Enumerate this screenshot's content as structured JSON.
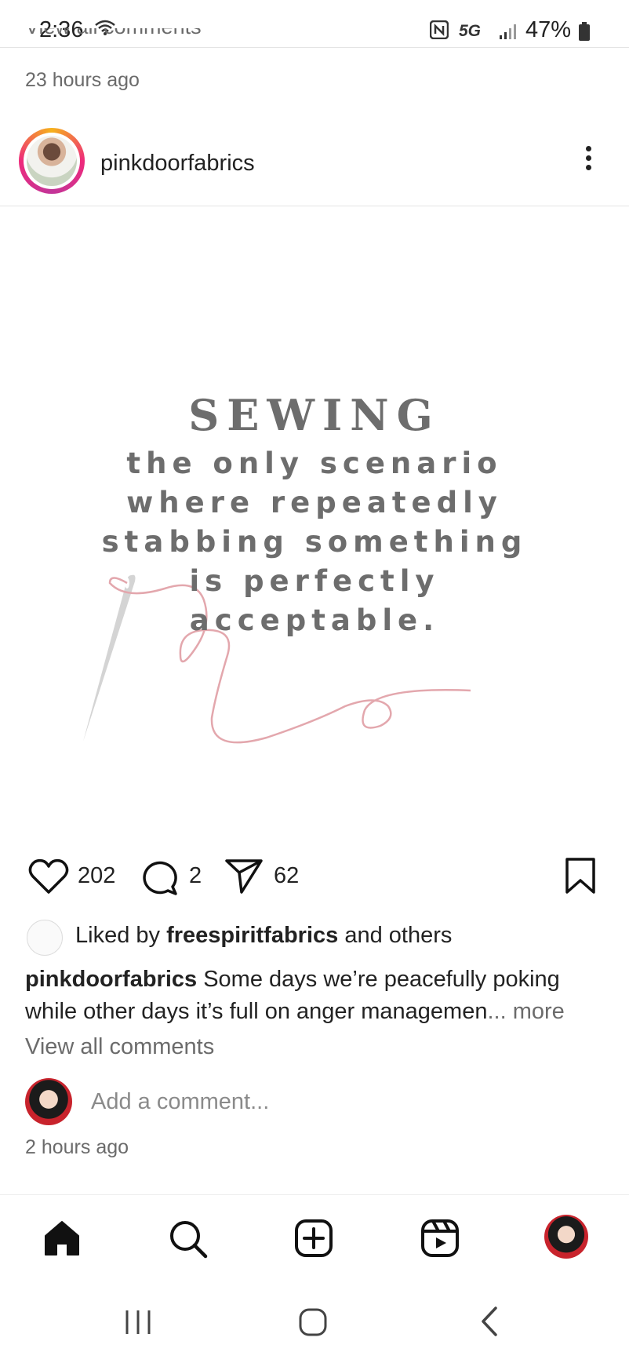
{
  "status_bar": {
    "time": "2:36",
    "network": "5G",
    "battery": "47%"
  },
  "previous_post": {
    "comments_link": "View all comments",
    "timestamp": "23 hours ago"
  },
  "post": {
    "username": "pinkdoorfabrics",
    "image_text": {
      "title": "SEWING",
      "lines": [
        "the only scenario",
        "where repeatedly",
        "stabbing something",
        "is perfectly",
        "acceptable."
      ]
    },
    "actions": {
      "likes": "202",
      "comments": "2",
      "shares": "62"
    },
    "liked_by": {
      "prefix": "Liked by ",
      "user": "freespiritfabrics",
      "suffix": " and others"
    },
    "caption": {
      "user": "pinkdoorfabrics",
      "text": " Some days we’re peacefully poking while other days it’s full on anger managemen",
      "more": "... more"
    },
    "view_comments": "View all comments",
    "add_comment_placeholder": "Add a comment...",
    "timestamp": "2 hours ago"
  },
  "colors": {
    "text": "#222222",
    "muted": "#6b6b6b",
    "quote": "#6d6d6d",
    "thread": "#e3a7ad"
  },
  "icons": [
    "home-icon",
    "search-icon",
    "create-icon",
    "reels-icon",
    "profile-icon",
    "heart-icon",
    "comment-icon",
    "share-icon",
    "bookmark-icon"
  ]
}
